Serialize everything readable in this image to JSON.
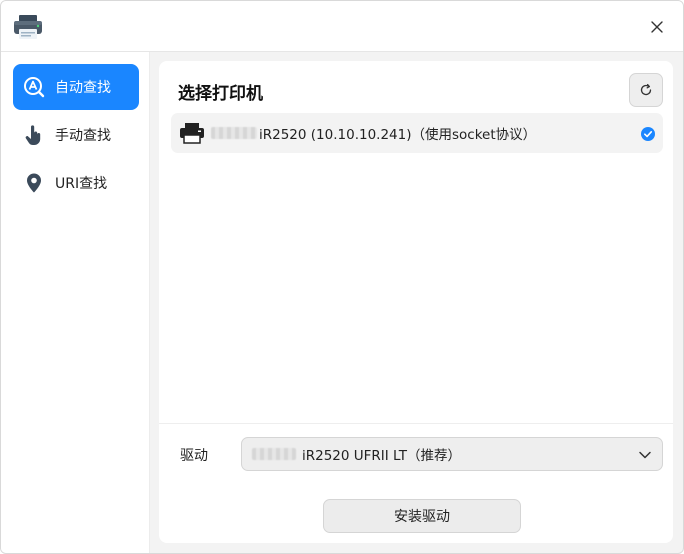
{
  "window": {
    "app_icon": "printer-app-icon",
    "close_icon": "close-icon"
  },
  "sidebar": {
    "items": [
      {
        "label": "自动查找",
        "icon": "auto-search-icon",
        "active": true
      },
      {
        "label": "手动查找",
        "icon": "hand-pointer-icon",
        "active": false
      },
      {
        "label": "URI查找",
        "icon": "location-pin-icon",
        "active": false
      }
    ]
  },
  "main": {
    "title": "选择打印机",
    "refresh_icon": "refresh-icon",
    "printers": [
      {
        "name": "iR2520 (10.10.10.241)（使用socket协议）",
        "selected": true
      }
    ],
    "driver_label": "驱动",
    "driver_value": "iR2520 UFRII LT（推荐）",
    "install_label": "安装驱动"
  },
  "colors": {
    "accent": "#1a86ff",
    "panel_bg": "#ffffff",
    "window_bg": "#f3f3f3"
  }
}
